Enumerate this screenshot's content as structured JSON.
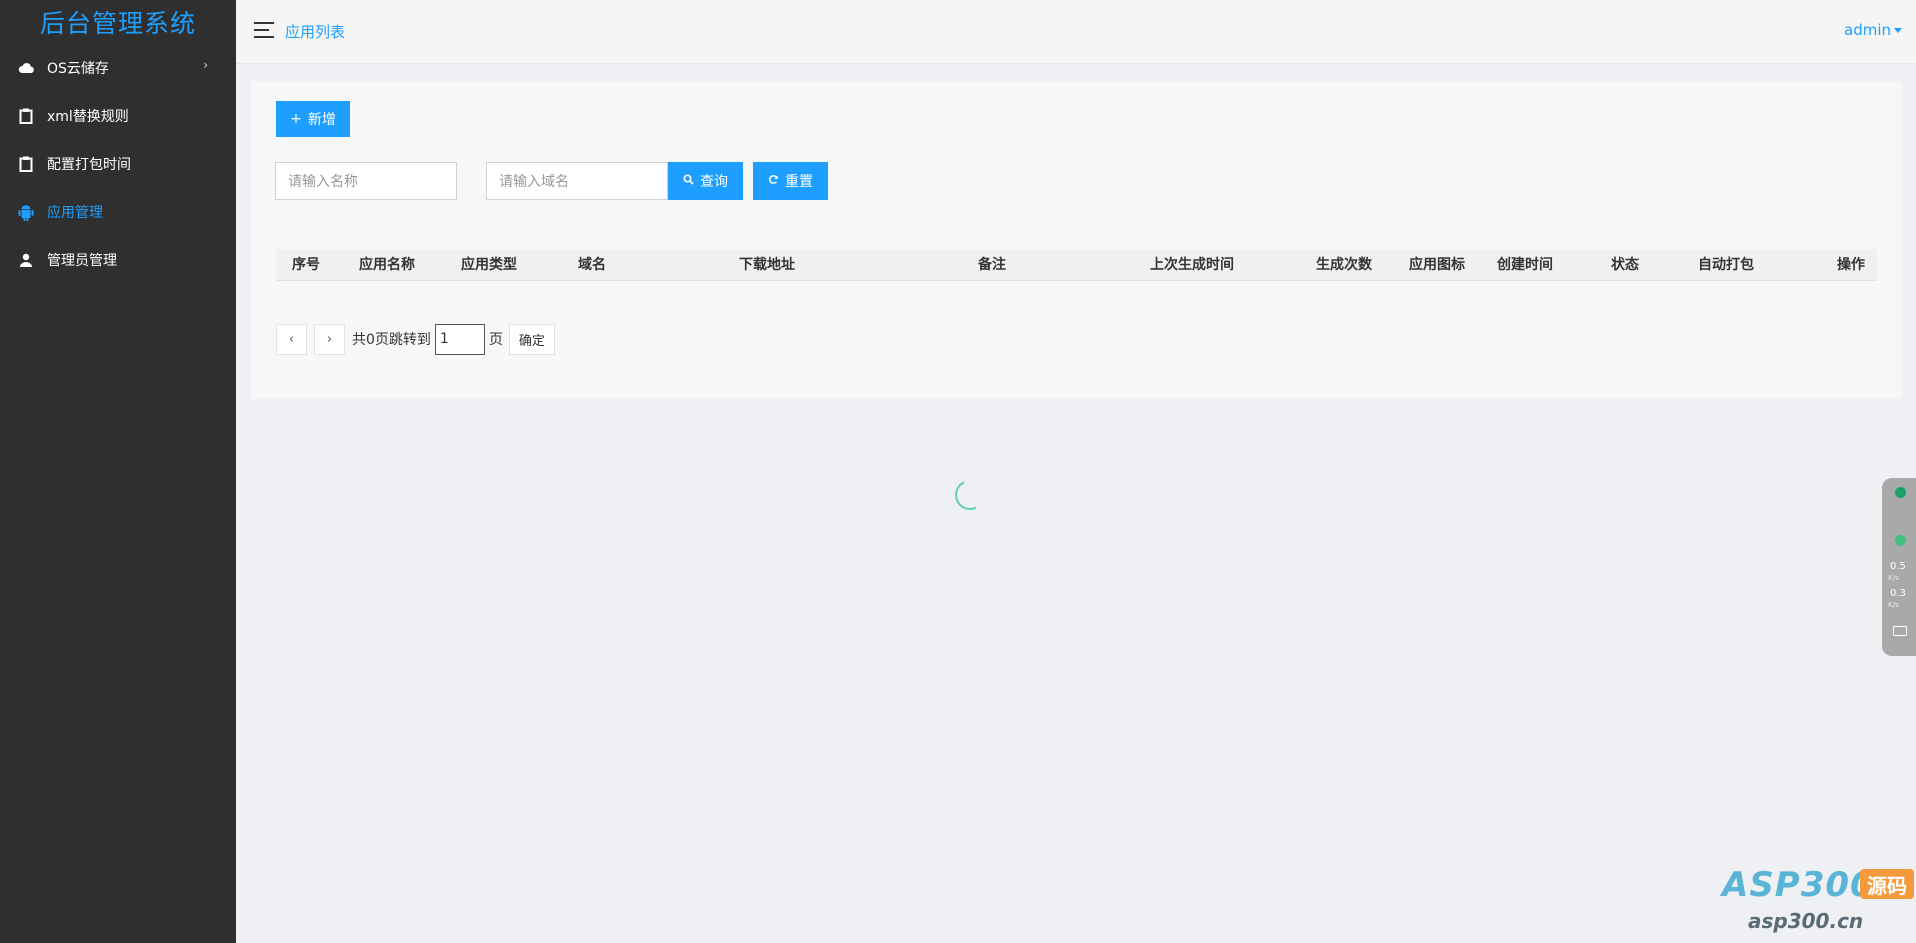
{
  "sidebar": {
    "brand": "后台管理系统",
    "items": [
      {
        "label": "OS云储存",
        "icon": "cloud-icon",
        "active": false,
        "has_arrow": true
      },
      {
        "label": "xml替换规则",
        "icon": "clipboard-icon",
        "active": false
      },
      {
        "label": "配置打包时间",
        "icon": "clipboard-icon",
        "active": false
      },
      {
        "label": "应用管理",
        "icon": "android-icon",
        "active": true
      },
      {
        "label": "管理员管理",
        "icon": "user-icon",
        "active": false
      }
    ],
    "arrow": "›"
  },
  "header": {
    "title": "应用列表",
    "user": "admin"
  },
  "toolbar": {
    "add_label": "新增",
    "add_icon": "+",
    "name_placeholder": "请输入名称",
    "domain_placeholder": "请输入域名",
    "search_label": "查询",
    "reset_label": "重置"
  },
  "table": {
    "columns": [
      "序号",
      "应用名称",
      "应用类型",
      "域名",
      "下载地址",
      "备注",
      "上次生成时间",
      "生成次数",
      "应用图标",
      "创建时间",
      "状态",
      "自动打包",
      "操作"
    ]
  },
  "pagination": {
    "prev": "‹",
    "next": "›",
    "total_text": "共0页跳转到",
    "page_value": "1",
    "page_unit": "页",
    "confirm": "确定"
  },
  "widget": {
    "up_value": "0.5",
    "down_value": "0.3",
    "unit": "K/s"
  },
  "watermark": {
    "main": "ASP300",
    "badge": "源码",
    "sub": "asp300.cn"
  },
  "colors": {
    "accent": "#1e9fff",
    "sidebar_bg": "#2f2f2f",
    "loader": "#5fd1b0"
  }
}
